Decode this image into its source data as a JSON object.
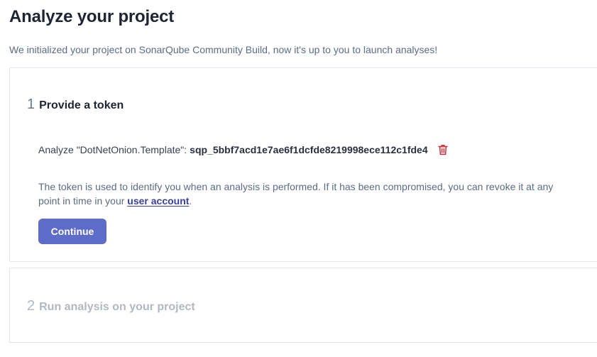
{
  "header": {
    "title": "Analyze your project",
    "subtitle": "We initialized your project on SonarQube Community Build, now it's up to you to launch analyses!"
  },
  "steps": [
    {
      "number": "1",
      "title": "Provide a token",
      "token_label": "Analyze \"DotNetOnion.Template\":",
      "token_value": "sqp_5bbf7acd1e7ae6f1dcfde8219998ece112c1fde4",
      "help_text_before": "The token is used to identify you when an analysis is performed. If it has been compromised, you can revoke it at any point in time in your ",
      "help_link": "user account",
      "help_text_after": ".",
      "continue_label": "Continue",
      "delete_icon": "trash-icon"
    },
    {
      "number": "2",
      "title": "Run analysis on your project"
    }
  ],
  "colors": {
    "primary_button": "#5d6cc7",
    "delete_icon": "#d02f3a",
    "muted_text": "#5d6b85",
    "disabled_text": "#b3b7c2",
    "link": "#3a3f9e"
  }
}
